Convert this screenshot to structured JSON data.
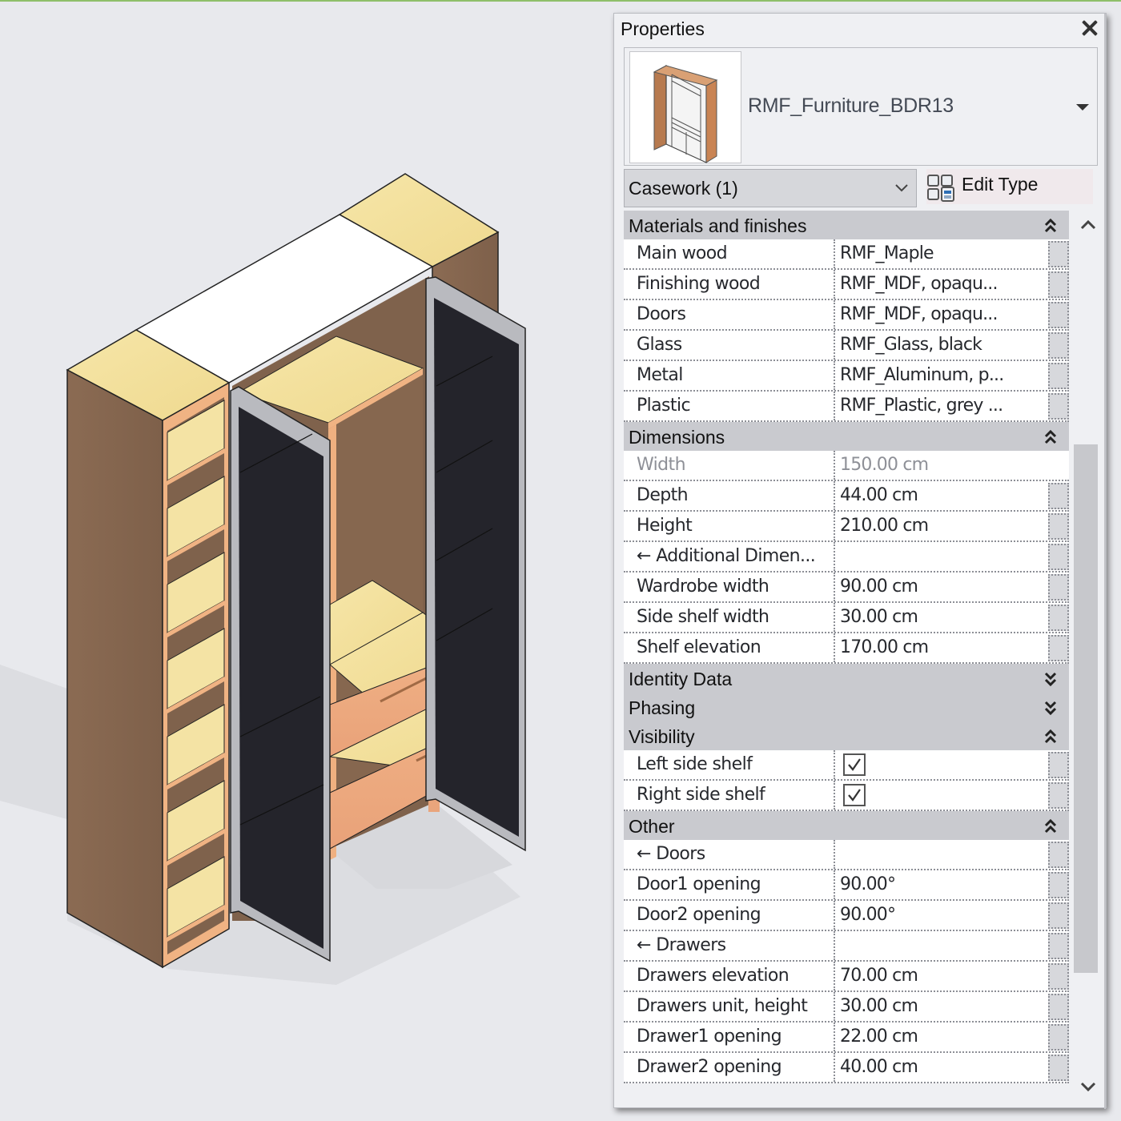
{
  "viewport": {
    "model_name": "wardrobe-3d-model",
    "colors": {
      "background": "#e8e9ed",
      "shadow": "#d3d4d9",
      "side_wood": "#8a6a52",
      "top_maple": "#f4e3a4",
      "edge_orange": "#f0b383",
      "top_white": "#ffffff",
      "glass": "#26262e",
      "frame": "#b7b8bd",
      "drawer_front": "#eeaa80"
    }
  },
  "properties": {
    "title": "Properties",
    "close_label": "close",
    "type_selector": {
      "name": "RMF_Furniture_BDR13"
    },
    "category_filter": {
      "value": "Casework (1)"
    },
    "edit_type_label": "Edit Type",
    "groups": [
      {
        "name": "Materials and finishes",
        "state": "expanded",
        "rows": [
          {
            "name": "Main wood",
            "value": "RMF_Maple"
          },
          {
            "name": "Finishing wood",
            "value": "RMF_MDF, opaqu..."
          },
          {
            "name": "Doors",
            "value": "RMF_MDF, opaqu..."
          },
          {
            "name": "Glass",
            "value": "RMF_Glass, black"
          },
          {
            "name": "Metal",
            "value": "RMF_Aluminum, p..."
          },
          {
            "name": "Plastic",
            "value": "RMF_Plastic, grey ..."
          }
        ]
      },
      {
        "name": "Dimensions",
        "state": "expanded",
        "rows": [
          {
            "name": "Width",
            "value": "150.00 cm",
            "readonly": true
          },
          {
            "name": "Depth",
            "value": "44.00 cm"
          },
          {
            "name": "Height",
            "value": "210.00 cm"
          },
          {
            "name": "← Additional Dimen...",
            "value": ""
          },
          {
            "name": "Wardrobe width",
            "value": "90.00 cm"
          },
          {
            "name": "Side shelf width",
            "value": "30.00 cm"
          },
          {
            "name": "Shelf elevation",
            "value": "170.00 cm"
          }
        ]
      },
      {
        "name": "Identity Data",
        "state": "collapsed",
        "rows": []
      },
      {
        "name": "Phasing",
        "state": "collapsed",
        "rows": []
      },
      {
        "name": "Visibility",
        "state": "expanded",
        "rows": [
          {
            "name": "Left side shelf",
            "checked": true
          },
          {
            "name": "Right side shelf",
            "checked": true
          }
        ]
      },
      {
        "name": "Other",
        "state": "expanded",
        "rows": [
          {
            "name": "← Doors",
            "value": ""
          },
          {
            "name": "Door1 opening",
            "value": "90.00°"
          },
          {
            "name": "Door2 opening",
            "value": "90.00°"
          },
          {
            "name": "← Drawers",
            "value": ""
          },
          {
            "name": "Drawers elevation",
            "value": "70.00 cm"
          },
          {
            "name": "Drawers unit, height",
            "value": "30.00 cm"
          },
          {
            "name": "Drawer1 opening",
            "value": "22.00 cm"
          },
          {
            "name": "Drawer2 opening",
            "value": "40.00 cm"
          }
        ]
      }
    ]
  }
}
